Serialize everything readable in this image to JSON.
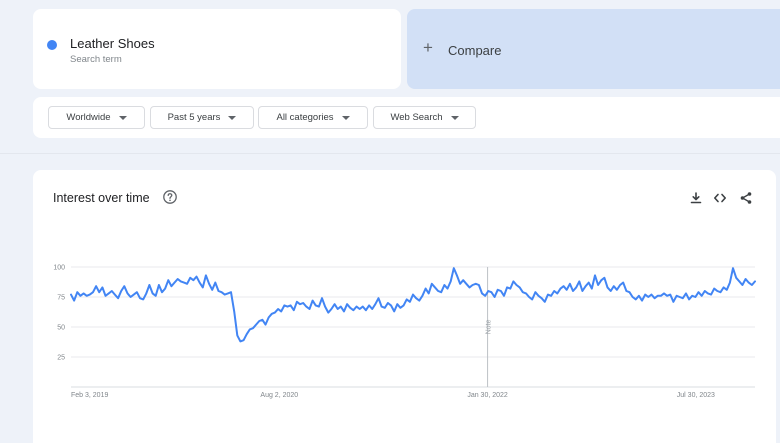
{
  "search_term": {
    "name": "Leather Shoes",
    "subtitle": "Search term",
    "color": "#4285f4"
  },
  "compare": {
    "label": "Compare",
    "icon": "plus-icon"
  },
  "filters": [
    {
      "label": "Worldwide"
    },
    {
      "label": "Past 5 years"
    },
    {
      "label": "All categories"
    },
    {
      "label": "Web Search"
    }
  ],
  "chart_section": {
    "title": "Interest over time",
    "help_icon": "help-circle-icon",
    "tools": [
      "download-icon",
      "embed-code-icon",
      "share-icon"
    ]
  },
  "chart_data": {
    "type": "line",
    "title": "",
    "xlabel": "",
    "ylabel": "",
    "ylim": [
      0,
      100
    ],
    "yticks": [
      100,
      75,
      50,
      25
    ],
    "xticks": [
      "Feb 3, 2019",
      "Aug 2, 2020",
      "Jan 30, 2022",
      "Jul 30, 2023"
    ],
    "xrange": [
      "Feb 3, 2019",
      "Jan 2024"
    ],
    "grid": true,
    "annotation": {
      "label": "Note",
      "at": "Jan 30, 2022"
    },
    "series": [
      {
        "color": "#4285f4",
        "values": [
          77,
          72,
          79,
          76,
          78,
          76,
          77,
          79,
          84,
          79,
          83,
          76,
          78,
          80,
          77,
          74,
          80,
          84,
          78,
          75,
          77,
          79,
          74,
          73,
          78,
          85,
          78,
          76,
          85,
          79,
          82,
          89,
          84,
          87,
          90,
          88,
          87,
          86,
          91,
          89,
          92,
          87,
          83,
          93,
          86,
          81,
          87,
          80,
          79,
          77,
          78,
          79,
          63,
          43,
          38,
          39,
          44,
          48,
          49,
          52,
          55,
          56,
          52,
          58,
          61,
          62,
          65,
          63,
          68,
          67,
          68,
          64,
          71,
          69,
          70,
          67,
          65,
          72,
          68,
          67,
          74,
          67,
          62,
          65,
          69,
          65,
          67,
          63,
          69,
          66,
          64,
          67,
          65,
          67,
          64,
          68,
          65,
          69,
          74,
          67,
          66,
          70,
          68,
          63,
          69,
          66,
          68,
          73,
          71,
          77,
          74,
          72,
          76,
          82,
          78,
          86,
          83,
          80,
          79,
          85,
          82,
          88,
          99,
          93,
          86,
          89,
          86,
          83,
          85,
          86,
          85,
          78,
          76,
          80,
          79,
          75,
          81,
          80,
          76,
          83,
          82,
          88,
          85,
          83,
          79,
          78,
          75,
          73,
          79,
          76,
          74,
          71,
          77,
          76,
          80,
          78,
          82,
          84,
          81,
          86,
          80,
          83,
          88,
          80,
          84,
          87,
          82,
          93,
          85,
          89,
          91,
          83,
          80,
          84,
          81,
          85,
          87,
          80,
          79,
          75,
          73,
          76,
          72,
          77,
          75,
          77,
          74,
          76,
          76,
          78,
          76,
          77,
          71,
          76,
          75,
          74,
          78,
          73,
          76,
          75,
          79,
          76,
          80,
          78,
          77,
          82,
          80,
          79,
          83,
          81,
          87,
          99,
          91,
          88,
          85,
          90,
          87,
          85,
          88
        ]
      }
    ]
  }
}
